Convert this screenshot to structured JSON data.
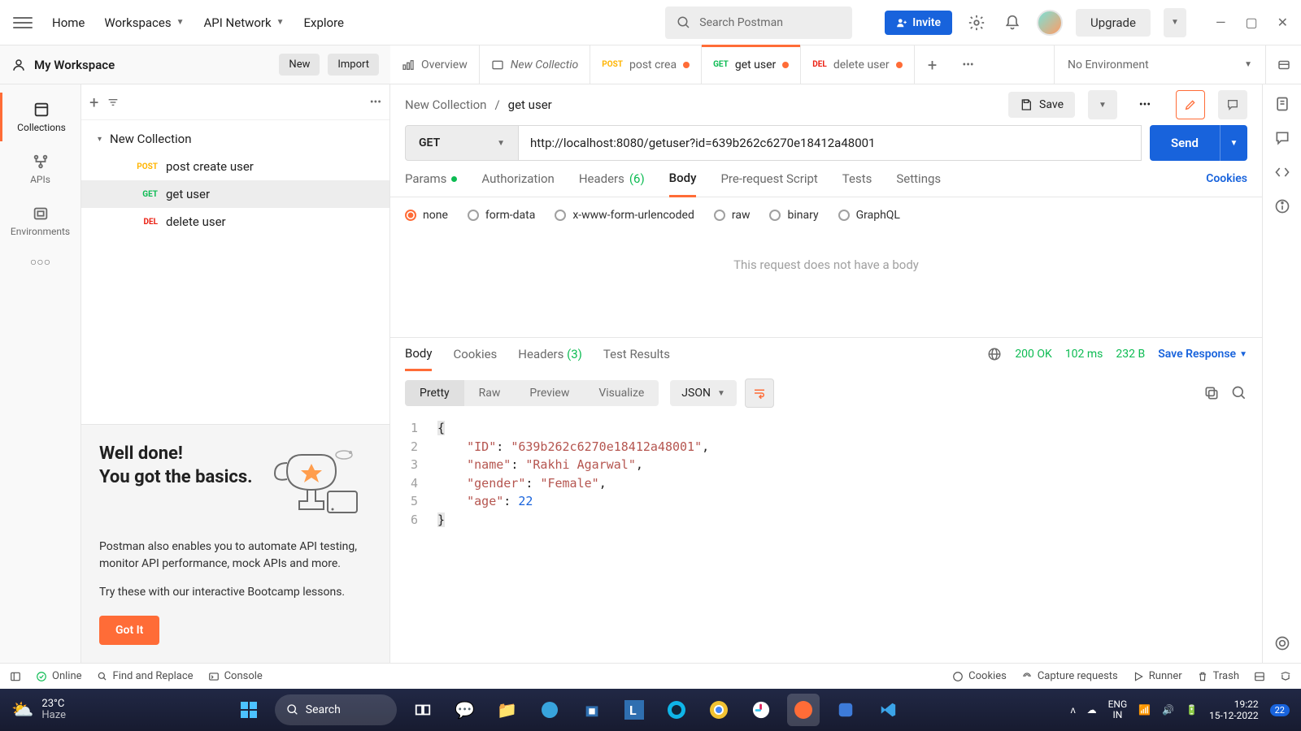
{
  "topnav": {
    "home": "Home",
    "workspaces": "Workspaces",
    "api_network": "API Network",
    "explore": "Explore"
  },
  "search_placeholder": "Search Postman",
  "invite_label": "Invite",
  "upgrade_label": "Upgrade",
  "workspace_name": "My Workspace",
  "new_btn": "New",
  "import_btn": "Import",
  "tabs": [
    {
      "label": "Overview",
      "type": "overview"
    },
    {
      "label": "New Collectio",
      "type": "folder"
    },
    {
      "method": "POST",
      "label": "post crea",
      "dirty": true
    },
    {
      "method": "GET",
      "label": "get user",
      "dirty": true,
      "active": true
    },
    {
      "method": "DEL",
      "label": "delete user",
      "dirty": true
    }
  ],
  "env_label": "No Environment",
  "rail": {
    "collections": "Collections",
    "apis": "APIs",
    "environments": "Environments"
  },
  "collection_name": "New Collection",
  "requests": [
    {
      "method": "POST",
      "name": "post create user"
    },
    {
      "method": "GET",
      "name": "get user",
      "active": true
    },
    {
      "method": "DEL",
      "name": "delete user"
    }
  ],
  "promo": {
    "title1": "Well done!",
    "title2": "You got the basics.",
    "p1": "Postman also enables you to automate API testing, monitor API performance, mock APIs and more.",
    "p2": "Try these with our interactive Bootcamp lessons.",
    "cta": "Got It"
  },
  "breadcrumb": {
    "parent": "New Collection",
    "current": "get user"
  },
  "save_label": "Save",
  "method": "GET",
  "url": "http://localhost:8080/getuser?id=639b262c6270e18412a48001",
  "send_label": "Send",
  "req_tabs": {
    "params": "Params",
    "auth": "Authorization",
    "headers": "Headers",
    "headers_count": "(6)",
    "body": "Body",
    "prereq": "Pre-request Script",
    "tests": "Tests",
    "settings": "Settings",
    "cookies": "Cookies"
  },
  "body_types": {
    "none": "none",
    "formdata": "form-data",
    "urlencoded": "x-www-form-urlencoded",
    "raw": "raw",
    "binary": "binary",
    "graphql": "GraphQL"
  },
  "empty_body_msg": "This request does not have a body",
  "resp_tabs": {
    "body": "Body",
    "cookies": "Cookies",
    "headers": "Headers",
    "headers_count": "(3)",
    "tests": "Test Results"
  },
  "resp_meta": {
    "status": "200 OK",
    "time": "102 ms",
    "size": "232 B",
    "save": "Save Response"
  },
  "view_modes": {
    "pretty": "Pretty",
    "raw": "Raw",
    "preview": "Preview",
    "visualize": "Visualize"
  },
  "format": "JSON",
  "response_json": {
    "ID": "639b262c6270e18412a48001",
    "name": "Rakhi Agarwal",
    "gender": "Female",
    "age": 22
  },
  "statusbar": {
    "online": "Online",
    "find": "Find and Replace",
    "console": "Console",
    "cookies": "Cookies",
    "capture": "Capture requests",
    "runner": "Runner",
    "trash": "Trash"
  },
  "taskbar": {
    "temp": "23°C",
    "cond": "Haze",
    "search": "Search",
    "lang": "ENG",
    "region": "IN",
    "time": "19:22",
    "date": "15-12-2022",
    "notif_count": "22"
  }
}
